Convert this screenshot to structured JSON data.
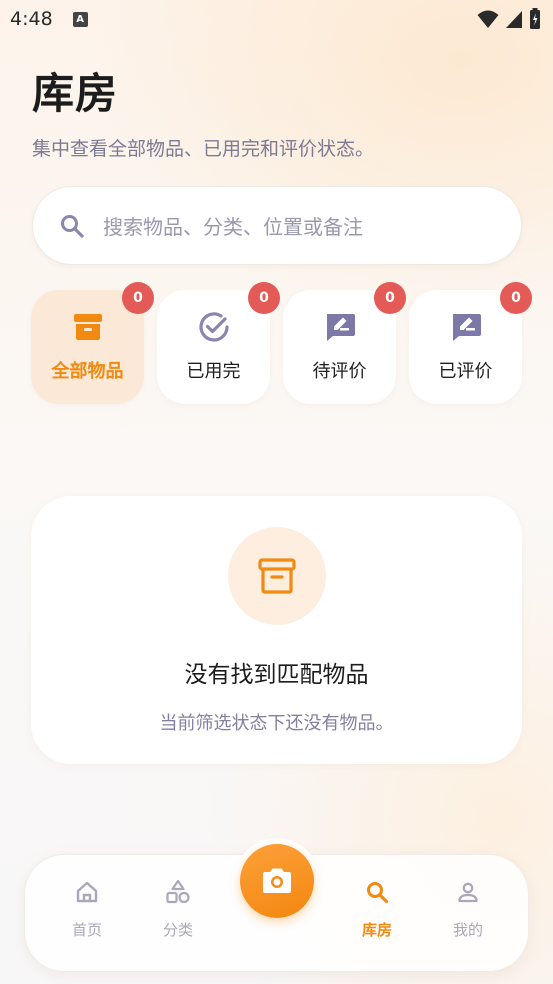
{
  "status_bar": {
    "time": "4:48",
    "notification_letter": "A"
  },
  "header": {
    "title": "库房",
    "subtitle": "集中查看全部物品、已用完和评价状态。"
  },
  "search": {
    "placeholder": "搜索物品、分类、位置或备注"
  },
  "filters": [
    {
      "label": "全部物品",
      "count": "0",
      "icon": "archive-icon",
      "active": true
    },
    {
      "label": "已用完",
      "count": "0",
      "icon": "check-circle-icon",
      "active": false
    },
    {
      "label": "待评价",
      "count": "0",
      "icon": "rate-edit-icon",
      "active": false
    },
    {
      "label": "已评价",
      "count": "0",
      "icon": "rate-edit-icon",
      "active": false
    }
  ],
  "empty_state": {
    "title": "没有找到匹配物品",
    "description": "当前筛选状态下还没有物品。"
  },
  "bottom_nav": {
    "items": [
      {
        "label": "首页",
        "icon": "home-icon",
        "active": false
      },
      {
        "label": "分类",
        "icon": "category-icon",
        "active": false
      },
      {
        "label": "库房",
        "icon": "search-icon",
        "active": true
      },
      {
        "label": "我的",
        "icon": "person-icon",
        "active": false
      }
    ],
    "center_action_icon": "camera-icon"
  },
  "colors": {
    "accent": "#f28a12",
    "badge": "#e35a56",
    "muted_icon": "#8a86b0",
    "muted_text": "#7d7a93"
  }
}
